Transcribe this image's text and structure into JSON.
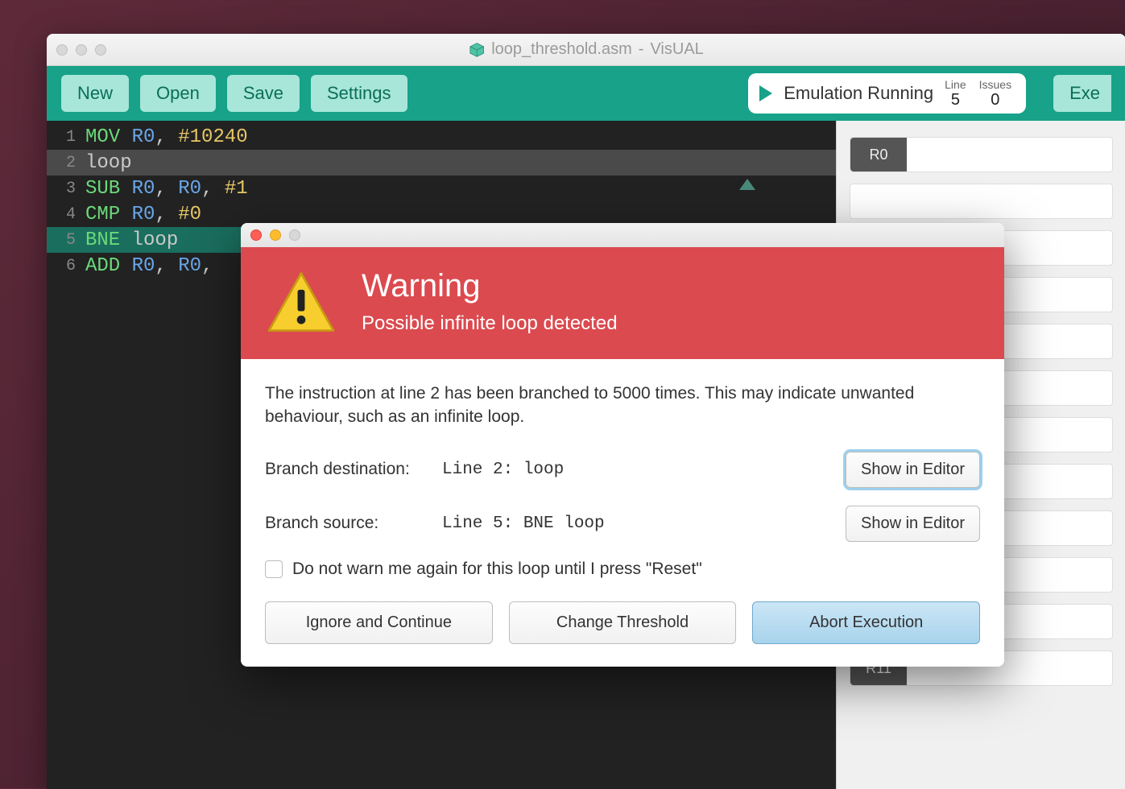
{
  "window": {
    "title_file": "loop_threshold.asm",
    "title_app": "VisUAL"
  },
  "toolbar": {
    "new": "New",
    "open": "Open",
    "save": "Save",
    "settings": "Settings",
    "execute": "Exe"
  },
  "status": {
    "text": "Emulation Running",
    "line_label": "Line",
    "line_value": "5",
    "issues_label": "Issues",
    "issues_value": "0"
  },
  "editor": {
    "lines": [
      {
        "n": "1",
        "tokens": [
          [
            "op",
            "MOV"
          ],
          [
            "sp",
            " "
          ],
          [
            "reg",
            "R0"
          ],
          [
            "punc",
            ","
          ],
          [
            "sp",
            " "
          ],
          [
            "num",
            "#10240"
          ]
        ]
      },
      {
        "n": "2",
        "hl": "gray",
        "tokens": [
          [
            "lbl",
            "loop"
          ]
        ]
      },
      {
        "n": "3",
        "tokens": [
          [
            "op",
            "SUB"
          ],
          [
            "sp",
            " "
          ],
          [
            "reg",
            "R0"
          ],
          [
            "punc",
            ","
          ],
          [
            "sp",
            " "
          ],
          [
            "reg",
            "R0"
          ],
          [
            "punc",
            ","
          ],
          [
            "sp",
            " "
          ],
          [
            "num",
            "#1"
          ]
        ]
      },
      {
        "n": "4",
        "tokens": [
          [
            "op",
            "CMP"
          ],
          [
            "sp",
            " "
          ],
          [
            "reg",
            "R0"
          ],
          [
            "punc",
            ","
          ],
          [
            "sp",
            " "
          ],
          [
            "num",
            "#0"
          ]
        ]
      },
      {
        "n": "5",
        "hl": "teal",
        "tokens": [
          [
            "op",
            "BNE"
          ],
          [
            "sp",
            " "
          ],
          [
            "lbl",
            "loop"
          ]
        ]
      },
      {
        "n": "6",
        "tokens": [
          [
            "op",
            "ADD"
          ],
          [
            "sp",
            " "
          ],
          [
            "reg",
            "R0"
          ],
          [
            "punc",
            ","
          ],
          [
            "sp",
            " "
          ],
          [
            "reg",
            "R0"
          ],
          [
            "punc",
            ","
          ]
        ]
      }
    ]
  },
  "registers": [
    "R0",
    "",
    "",
    "",
    "",
    "",
    "",
    "",
    "",
    "",
    "",
    "R11"
  ],
  "dialog": {
    "title": "Warning",
    "subtitle": "Possible infinite loop detected",
    "message": "The instruction at line 2 has been branched to 5000 times. This may indicate unwanted behaviour, such as an infinite loop.",
    "branch_dest_label": "Branch destination:",
    "branch_dest_value": "Line 2: loop",
    "branch_src_label": "Branch source:",
    "branch_src_value": "Line 5: BNE loop",
    "show_in_editor": "Show in Editor",
    "checkbox_label": "Do not warn me again for this loop until I press \"Reset\"",
    "ignore": "Ignore and Continue",
    "change": "Change Threshold",
    "abort": "Abort Execution"
  }
}
